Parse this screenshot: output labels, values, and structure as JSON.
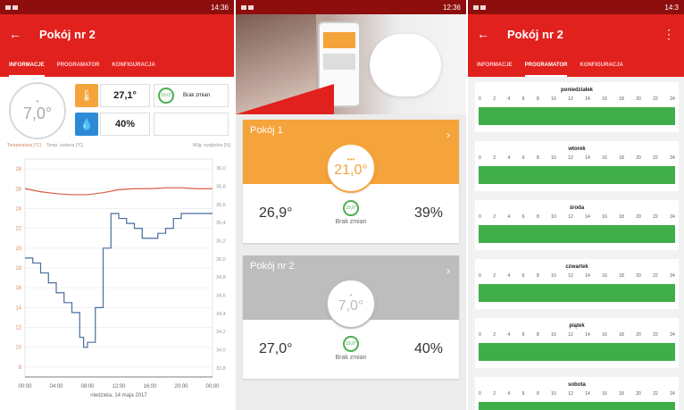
{
  "status": {
    "left": {
      "time": "14:36",
      "battery": "68%"
    },
    "middle": {
      "time": "12:36",
      "battery": "80%"
    },
    "right": {
      "time": "14:3",
      "battery": "68%"
    }
  },
  "left_screen": {
    "title": "Pokój nr 2",
    "tabs": [
      "INFORMACJE",
      "PROGRAMATOR",
      "KONFIGURACJA"
    ],
    "dial_value": "7,0°",
    "temperature": "27,1°",
    "humidity": "40%",
    "status_label": "Brak zmian",
    "status_badge": "19,0°",
    "legend": {
      "temp": "Temperatura [°C]",
      "setpoint": "Temp. zadana [°C]",
      "humidity": "Wilg. względna [%]"
    },
    "x_caption": "niedziela, 14 maja 2017"
  },
  "middle_screen": {
    "rooms": [
      {
        "name": "Pokój 1",
        "setpoint": "21,0°",
        "temperature": "26,9°",
        "humidity": "39%",
        "status": "Brak zmian",
        "badge": "19,0°",
        "color": "#f5a33b"
      },
      {
        "name": "Pokój nr 2",
        "setpoint": "7,0°",
        "temperature": "27,0°",
        "humidity": "40%",
        "status": "Brak zmian",
        "badge": "19,0°",
        "color": "#bdbdbd"
      }
    ]
  },
  "right_screen": {
    "title": "Pokój nr 2",
    "tabs": [
      "INFORMACJE",
      "PROGRAMATOR",
      "KONFIGURACJA"
    ],
    "hour_ticks": [
      "0",
      "2",
      "4",
      "6",
      "8",
      "10",
      "12",
      "14",
      "16",
      "18",
      "20",
      "22",
      "24"
    ],
    "days": [
      "poniedziałek",
      "wtorek",
      "środa",
      "czwartek",
      "piątek",
      "sobota"
    ],
    "bar_color": "#3fae49"
  },
  "chart_data": {
    "type": "line",
    "x": [
      "00:00",
      "04:00",
      "08:00",
      "12:00",
      "16:00",
      "20:00",
      "00:00"
    ],
    "y_left_ticks": [
      8,
      10,
      12,
      14,
      16,
      18,
      20,
      22,
      24,
      26,
      28
    ],
    "y_right_ticks": [
      "33,8",
      "34,0",
      "34,2",
      "34,4",
      "34,6",
      "34,8",
      "35,0",
      "35,2",
      "35,4",
      "35,6",
      "35,8",
      "36,0"
    ],
    "ylim": [
      7,
      29
    ],
    "series": [
      {
        "name": "Temperatura [°C]",
        "color": "#d95b4a",
        "x": [
          0,
          2,
          4,
          6,
          8,
          10,
          12,
          14,
          16,
          18,
          20,
          22,
          24
        ],
        "values": [
          26,
          25.7,
          25.5,
          25.4,
          25.4,
          25.6,
          25.9,
          26,
          26,
          26.1,
          26.1,
          26,
          26
        ]
      },
      {
        "name": "Temp. zadana [°C]",
        "color": "#999999",
        "x": [
          0,
          24
        ],
        "values": [
          7,
          7
        ]
      },
      {
        "name": "Wilg. względna [%]",
        "color": "#4a6d9e",
        "x": [
          0,
          1,
          2,
          3,
          4,
          5,
          6,
          7,
          7.5,
          8,
          9,
          10,
          11,
          12,
          13,
          14,
          15,
          16,
          17,
          18,
          19,
          20,
          21,
          22,
          23,
          24
        ],
        "values": [
          19,
          18.5,
          17.5,
          16.5,
          15.5,
          14.5,
          13.5,
          11,
          10,
          10.5,
          14,
          20,
          23.5,
          23,
          22.5,
          22,
          21,
          21,
          21.5,
          22,
          23,
          23.5,
          23.5,
          23.5,
          23.5,
          23.5
        ]
      }
    ]
  }
}
